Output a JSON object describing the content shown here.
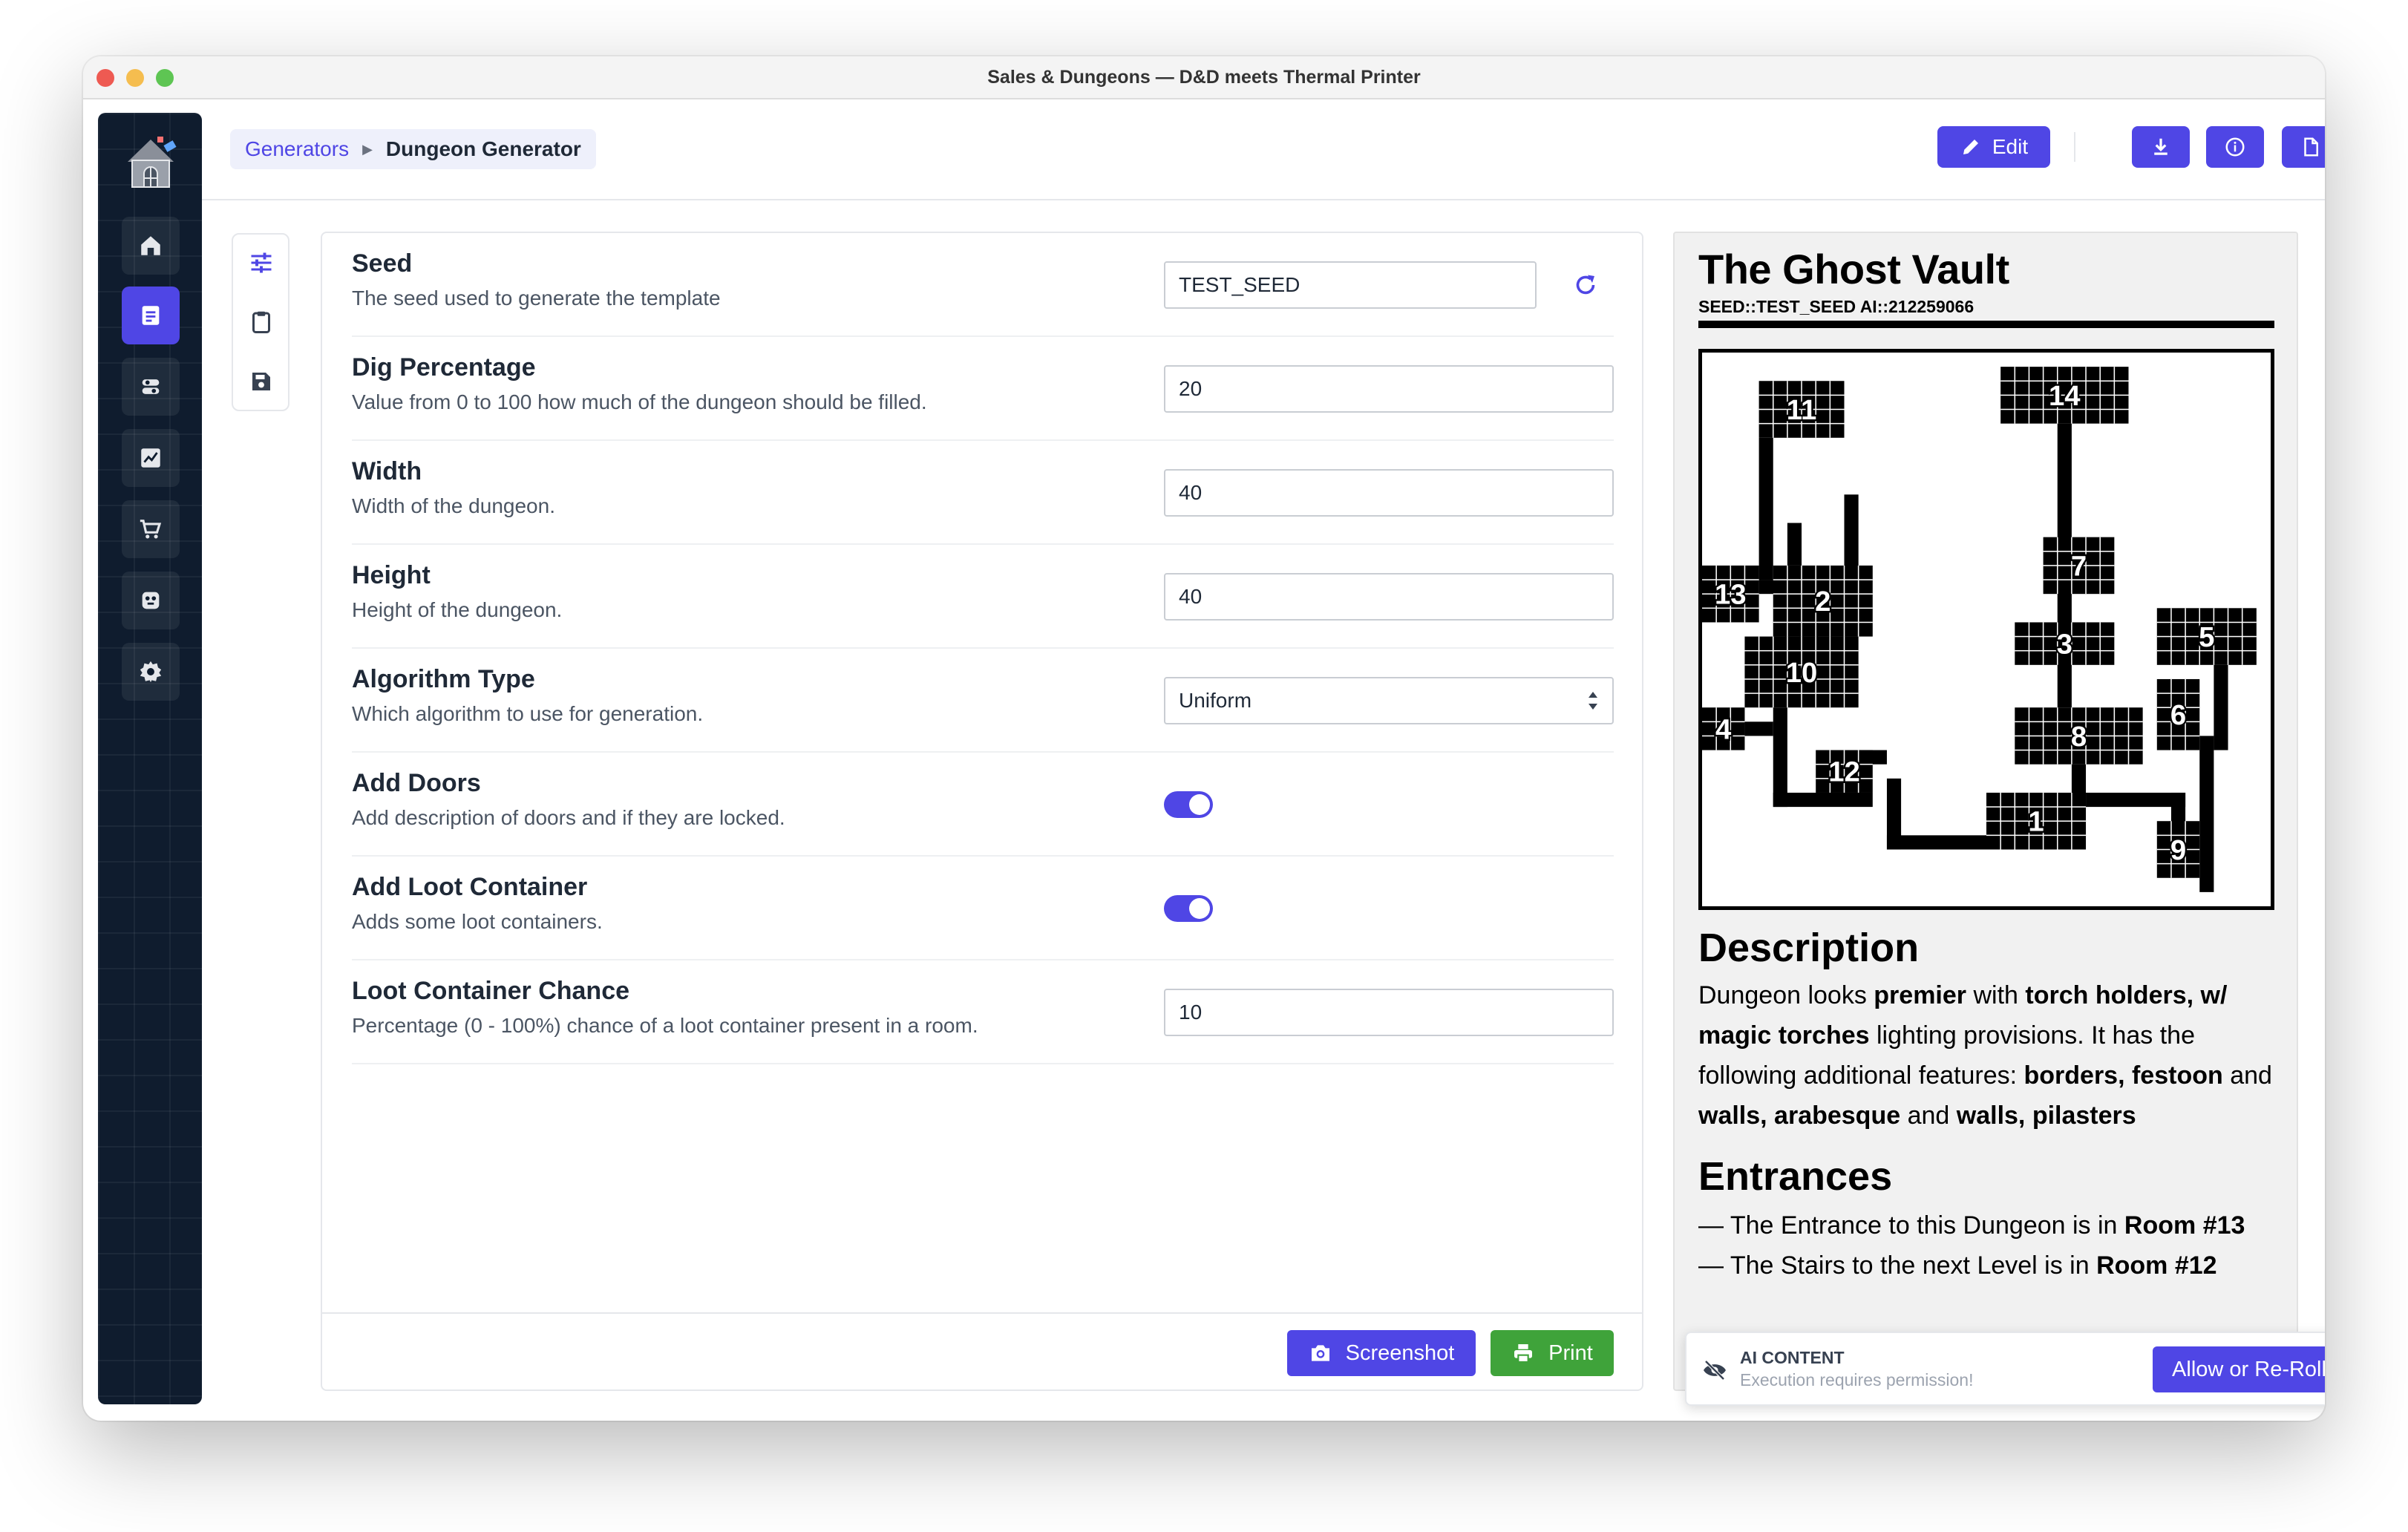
{
  "window": {
    "title": "Sales & Dungeons — D&D meets Thermal Printer"
  },
  "sidebar": {
    "items": [
      "home-icon",
      "template-icon",
      "generator-icon",
      "chart-icon",
      "cart-icon",
      "plugin-icon",
      "gear-icon"
    ],
    "active": "template-icon"
  },
  "breadcrumb": {
    "parent": "Generators",
    "current": "Dungeon Generator"
  },
  "header": {
    "edit_label": "Edit",
    "actions": [
      "download-icon",
      "info-icon",
      "copy-icon",
      "trash-icon"
    ]
  },
  "form": {
    "rows": [
      {
        "label": "Seed",
        "description": "The seed used to generate the template",
        "value": "TEST_SEED"
      },
      {
        "label": "Dig Percentage",
        "description": "Value from 0 to 100 how much of the dungeon should be filled.",
        "value": "20"
      },
      {
        "label": "Width",
        "description": "Width of the dungeon.",
        "value": "40"
      },
      {
        "label": "Height",
        "description": "Height of the dungeon.",
        "value": "40"
      },
      {
        "label": "Algorithm Type",
        "description": "Which algorithm to use for generation.",
        "value": "Uniform"
      },
      {
        "label": "Add Doors",
        "description": "Add description of doors and if they are locked.",
        "checked": true
      },
      {
        "label": "Add Loot Container",
        "description": "Adds some loot containers.",
        "checked": true
      },
      {
        "label": "Loot Container Chance",
        "description": "Percentage (0 - 100%) chance of a loot container present in a room.",
        "value": "10"
      }
    ],
    "screenshot_label": "Screenshot",
    "print_label": "Print"
  },
  "preview": {
    "title": "The Ghost Vault",
    "subtitle": "SEED::TEST_SEED AI::212259066",
    "map_rooms": [
      "11",
      "14",
      "7",
      "13",
      "2",
      "3",
      "5",
      "10",
      "6",
      "4",
      "8",
      "12",
      "1",
      "9"
    ],
    "description_heading": "Description",
    "description": {
      "t1": "Dungeon looks ",
      "b1": "premier",
      "t2": " with ",
      "b2": "torch holders, w/ magic torches",
      "t3": " lighting provisions. It has the following additional features: ",
      "b3": "borders, festoon",
      "t4": " and ",
      "b4": "walls, arabesque",
      "t5": " and ",
      "b5": "walls, pilasters"
    },
    "entrances_heading": "Entrances",
    "entrances": [
      {
        "text": "— The Entrance to this Dungeon is in ",
        "room": "Room #13"
      },
      {
        "text": "— The Stairs to the next Level is in ",
        "room": "Room #12"
      }
    ]
  },
  "ai": {
    "title": "AI CONTENT",
    "description": "Execution requires permission!",
    "button_label": "Allow or Re-Roll"
  }
}
